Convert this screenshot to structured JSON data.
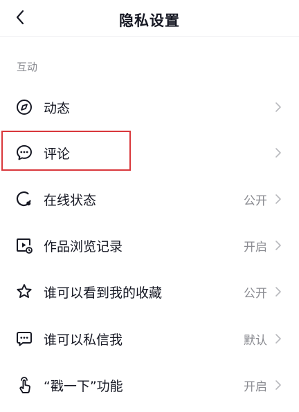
{
  "header": {
    "back_icon": "chevron-left-icon",
    "title": "隐私设置"
  },
  "section": {
    "label": "互动"
  },
  "items": [
    {
      "label": "动态",
      "value": "",
      "icon": "compass-icon"
    },
    {
      "label": "评论",
      "value": "",
      "icon": "comment-icon"
    },
    {
      "label": "在线状态",
      "value": "公开",
      "icon": "online-status-icon"
    },
    {
      "label": "作品浏览记录",
      "value": "开启",
      "icon": "view-history-icon"
    },
    {
      "label": "谁可以看到我的收藏",
      "value": "公开",
      "icon": "star-icon"
    },
    {
      "label": "谁可以私信我",
      "value": "默认",
      "icon": "message-icon"
    },
    {
      "label": "“戳一下”功能",
      "value": "开启",
      "icon": "poke-hand-icon"
    }
  ],
  "colors": {
    "highlight": "#d9373b",
    "secondary_text": "#8a8b91",
    "primary_text": "#161823"
  }
}
